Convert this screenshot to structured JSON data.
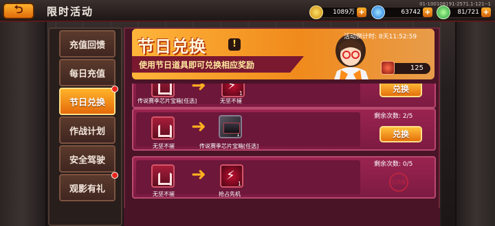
{
  "header": {
    "back_glyph": "⮌",
    "title": "限时活动",
    "server_id": "01-100108191-2571.1-121--1",
    "resources": [
      {
        "icon": "gold-coin-icon",
        "value": "1089万",
        "color": "#f2b21c"
      },
      {
        "icon": "diamond-icon",
        "value": "63742",
        "color": "#2fb8ff"
      },
      {
        "icon": "energy-icon",
        "value": "81/721",
        "color": "#4ed06a"
      }
    ],
    "plus": "+"
  },
  "tabs": [
    {
      "label": "充值回馈",
      "active": false,
      "dot": false
    },
    {
      "label": "每日充值",
      "active": false,
      "dot": false
    },
    {
      "label": "节日兑换",
      "active": true,
      "dot": true
    },
    {
      "label": "作战计划",
      "active": false,
      "dot": false
    },
    {
      "label": "安全驾驶",
      "active": false,
      "dot": false
    },
    {
      "label": "观影有礼",
      "active": false,
      "dot": true
    }
  ],
  "banner": {
    "title": "节日兑换",
    "info": "!",
    "subtitle": "使用节日道具即可兑换相应奖励",
    "countdown": "活动倒计时: 8天11:52:59",
    "token_count": "125"
  },
  "rows": [
    {
      "input": {
        "icon": "defense-chip-icon",
        "count": "1",
        "name": "无坚不摧"
      },
      "output": {
        "icon": "chip-box-icon",
        "count": "1",
        "name": "传说赛季芯片宝箱[任选]"
      },
      "remaining": "",
      "button": "兑换",
      "stamp": ""
    },
    {
      "input": {
        "icon": "defense-chip-icon",
        "count": "1",
        "name": "无坚不摧"
      },
      "output": {
        "icon": "chip-box-icon",
        "count": "1",
        "name": "传说赛季芯片宝箱[任选]"
      },
      "remaining": "剩余次数:    2/5",
      "button": "兑换",
      "stamp": ""
    },
    {
      "input": {
        "icon": "defense-chip-icon",
        "count": "1",
        "name": "无坚不摧"
      },
      "output": {
        "icon": "preempt-bolt-icon",
        "count": "1",
        "name": "抢占先机"
      },
      "remaining": "剩余次数:    0/5",
      "button": "",
      "stamp": "已兑换"
    }
  ],
  "arrow_glyph": "➜"
}
